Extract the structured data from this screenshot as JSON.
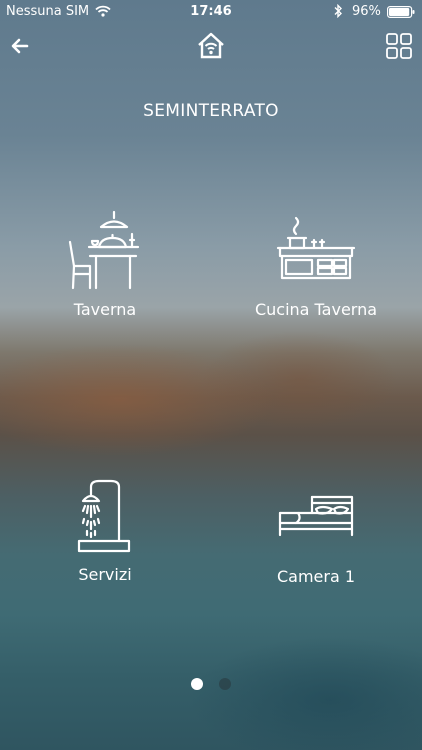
{
  "status_bar": {
    "carrier": "Nessuna SIM",
    "time": "17:46",
    "battery_percent": "96%",
    "battery_level": 0.96,
    "icons": [
      "wifi-icon",
      "bluetooth-icon",
      "battery-icon"
    ]
  },
  "nav": {
    "back_icon": "arrow-left-icon",
    "home_icon": "home-wifi-icon",
    "grid_icon": "grid-icon"
  },
  "floor_title": "SEMINTERRATO",
  "rooms": [
    {
      "label": "Taverna",
      "icon": "dining-table-icon"
    },
    {
      "label": "Cucina Taverna",
      "icon": "kitchen-icon"
    },
    {
      "label": "Servizi",
      "icon": "shower-icon"
    },
    {
      "label": "Camera 1",
      "icon": "bed-icon"
    }
  ],
  "pagination": {
    "total": 2,
    "current": 1
  },
  "colors": {
    "text": "#ffffff",
    "dot_active": "#ffffff"
  }
}
